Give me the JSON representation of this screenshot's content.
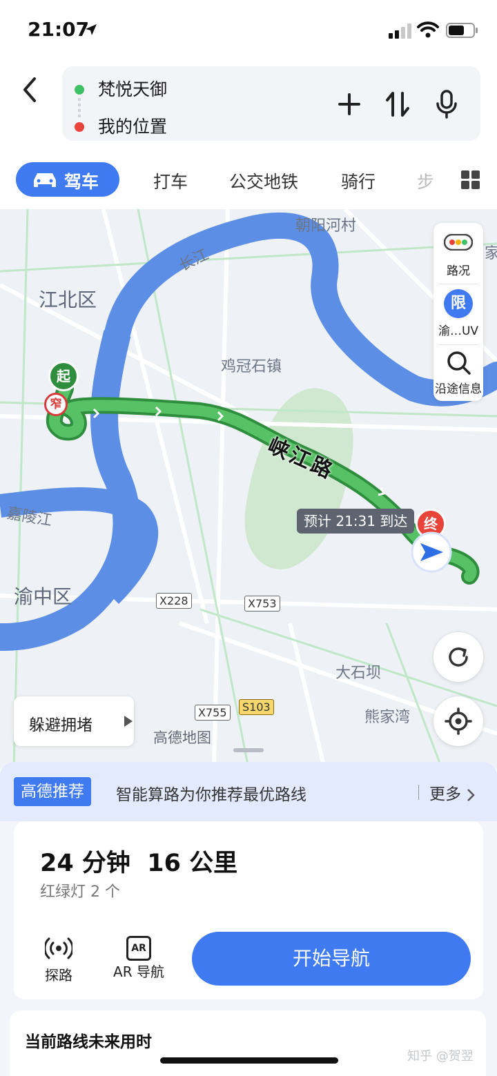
{
  "status_bar": {
    "time": "21:07"
  },
  "route": {
    "origin": "梵悦天御",
    "destination": "我的位置"
  },
  "modes": {
    "active": "驾车",
    "items": [
      "打车",
      "公交地铁",
      "骑行",
      "步"
    ]
  },
  "map": {
    "labels": {
      "chaoyang": "朝阳河村",
      "changjiang": "长江",
      "jiangbei": "江北区",
      "jiguan": "鸡冠石镇",
      "jialing": "嘉陵江",
      "yuzhong": "渝中区",
      "dashiba": "大石坝",
      "xiongjia": "熊家湾",
      "jia": "家"
    },
    "roads": {
      "x228": "X228",
      "x753": "X753",
      "x755": "X755",
      "s103": "S103"
    },
    "route_road": "峡江路",
    "start_marker": "起",
    "narrow_marker": "窄",
    "end_marker": "终",
    "eta": "预计 21:31 到达",
    "side": {
      "traffic": "路况",
      "limit_icon": "限",
      "limit": "渝…UV",
      "along": "沿途信息"
    },
    "avoid": "躲避拥堵",
    "provider": "高德地图"
  },
  "recommend": {
    "tag": "高德推荐",
    "text": "智能算路为你推荐最优路线",
    "more": "更多"
  },
  "plan": {
    "duration": "24 分钟",
    "distance": "16 公里",
    "lights": "红绿灯 2 个",
    "explore": "探路",
    "ar": "AR 导航",
    "ar_icon": "AR",
    "start_nav": "开始导航"
  },
  "future": {
    "title": "当前路线未来用时"
  },
  "watermark": "知乎 @贺翌"
}
